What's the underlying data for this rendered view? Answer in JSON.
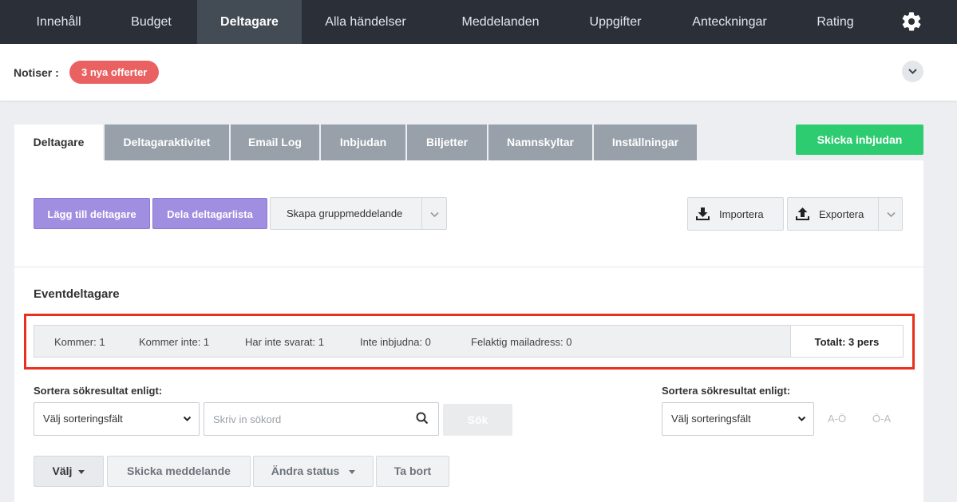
{
  "nav": {
    "items": [
      {
        "label": "Innehåll"
      },
      {
        "label": "Budget"
      },
      {
        "label": "Deltagare"
      },
      {
        "label": "Alla händelser"
      },
      {
        "label": "Meddelanden"
      },
      {
        "label": "Uppgifter"
      },
      {
        "label": "Anteckningar"
      },
      {
        "label": "Rating"
      }
    ],
    "active": "Deltagare",
    "settings_icon": "gear-icon"
  },
  "notices": {
    "label": "Notiser :",
    "badge": "3 nya offerter",
    "badge_color": "#ea6162"
  },
  "tabs": {
    "items": [
      {
        "label": "Deltagare"
      },
      {
        "label": "Deltagaraktivitet"
      },
      {
        "label": "Email Log"
      },
      {
        "label": "Inbjudan"
      },
      {
        "label": "Biljetter"
      },
      {
        "label": "Namnskyltar"
      },
      {
        "label": "Inställningar"
      }
    ],
    "active": "Deltagare",
    "send_invite": "Skicka inbjudan"
  },
  "toolbar": {
    "add_participant": "Lägg till deltagare",
    "share_list": "Dela deltagarlista",
    "group_message": "Skapa gruppmeddelande",
    "import": "Importera",
    "export": "Exportera"
  },
  "section": {
    "title": "Eventdeltagare"
  },
  "stats": {
    "coming": "Kommer: 1",
    "not_coming": "Kommer inte: 1",
    "no_answer": "Har inte svarat: 1",
    "not_invited": "Inte inbjudna: 0",
    "bad_email": "Felaktig mailadress: 0",
    "total": "Totalt: 3 pers"
  },
  "sort": {
    "label_left": "Sortera sökresultat enligt:",
    "select_left": "Välj sorteringsfält",
    "search_placeholder": "Skriv in sökord",
    "search_button": "Sök",
    "label_right": "Sortera sökresultat enligt:",
    "select_right": "Välj sorteringsfält",
    "asc": "A-Ö",
    "desc": "Ö-A"
  },
  "actions": {
    "select": "Välj",
    "send_message": "Skicka meddelande",
    "change_status": "Ändra status",
    "delete": "Ta bort"
  },
  "colors": {
    "accent_purple": "#a08ee0",
    "accent_green": "#2ecc71",
    "nav_bg": "#2b3038",
    "highlight": "#e8301c"
  }
}
